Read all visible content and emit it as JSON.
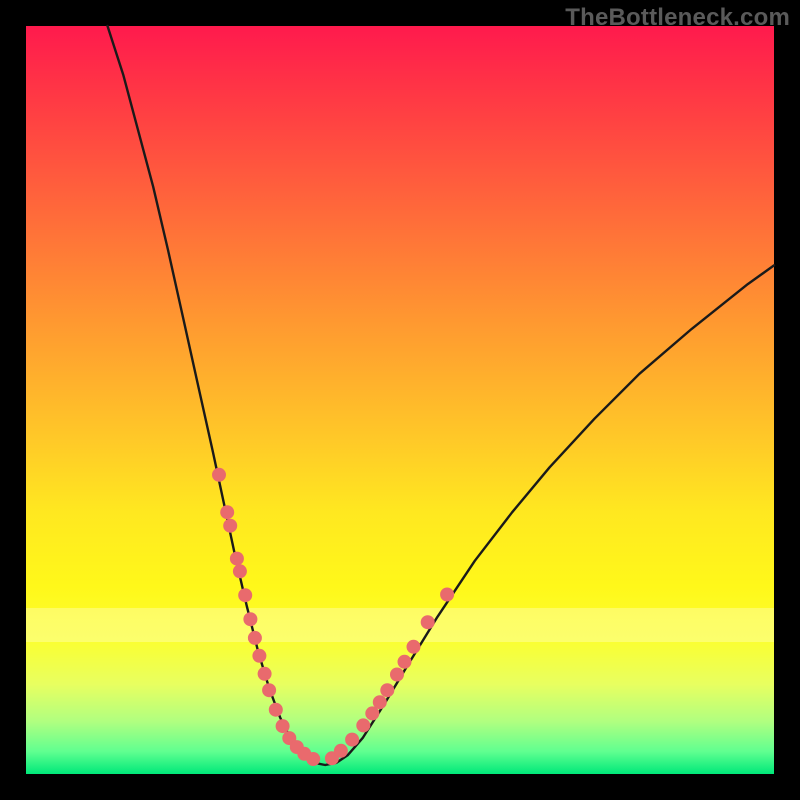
{
  "watermark": "TheBottleneck.com",
  "colors": {
    "background": "#000000",
    "curve": "#1a1a1a",
    "dots": "#e96a6d",
    "gradient_top": "#ff1a4d",
    "gradient_bottom": "#00e87a"
  },
  "chart_data": {
    "type": "line",
    "title": "",
    "xlabel": "",
    "ylabel": "",
    "xlim": [
      0,
      100
    ],
    "ylim": [
      0,
      100
    ],
    "legend": false,
    "grid": false,
    "description": "Bottleneck curve: V-shaped profile with steep left descent to a minimum near x≈35, then a gentler rise to the right. Overlaid highlighted data points (salmon dots) cluster along both branches near the valley floor.",
    "series": [
      {
        "name": "bottleneck-curve",
        "type": "line",
        "x": [
          10.9,
          13.0,
          15.0,
          17.0,
          19.0,
          21.0,
          23.0,
          25.0,
          26.5,
          28.0,
          29.5,
          31.0,
          32.5,
          34.0,
          35.5,
          37.0,
          38.5,
          40.0,
          41.5,
          43.0,
          45.0,
          48.0,
          51.0,
          55.0,
          60.0,
          65.0,
          70.0,
          76.0,
          82.0,
          89.0,
          96.5,
          100.0
        ],
        "y": [
          100.0,
          93.5,
          86.0,
          78.5,
          70.0,
          61.0,
          52.0,
          43.0,
          36.0,
          29.0,
          22.5,
          16.5,
          11.5,
          7.5,
          4.5,
          2.5,
          1.5,
          1.2,
          1.5,
          2.5,
          4.8,
          9.5,
          14.5,
          21.0,
          28.5,
          35.0,
          41.0,
          47.5,
          53.5,
          59.5,
          65.5,
          68.0
        ]
      },
      {
        "name": "highlighted-points",
        "type": "scatter",
        "x": [
          25.8,
          26.9,
          27.3,
          28.2,
          28.6,
          29.3,
          30.0,
          30.6,
          31.2,
          31.9,
          32.5,
          33.4,
          34.3,
          35.2,
          36.2,
          37.2,
          38.4,
          40.9,
          42.1,
          43.6,
          45.1,
          46.3,
          47.3,
          48.3,
          49.6,
          50.6,
          51.8,
          53.7,
          56.3
        ],
        "y": [
          40.0,
          35.0,
          33.2,
          28.8,
          27.1,
          23.9,
          20.7,
          18.2,
          15.8,
          13.4,
          11.2,
          8.6,
          6.4,
          4.8,
          3.6,
          2.7,
          2.0,
          2.1,
          3.1,
          4.6,
          6.5,
          8.1,
          9.6,
          11.2,
          13.3,
          15.0,
          17.0,
          20.3,
          24.0
        ]
      }
    ],
    "bands": [
      {
        "y0": 17.5,
        "y1": 22.0,
        "note": "pale horizontal band near valley"
      }
    ]
  }
}
